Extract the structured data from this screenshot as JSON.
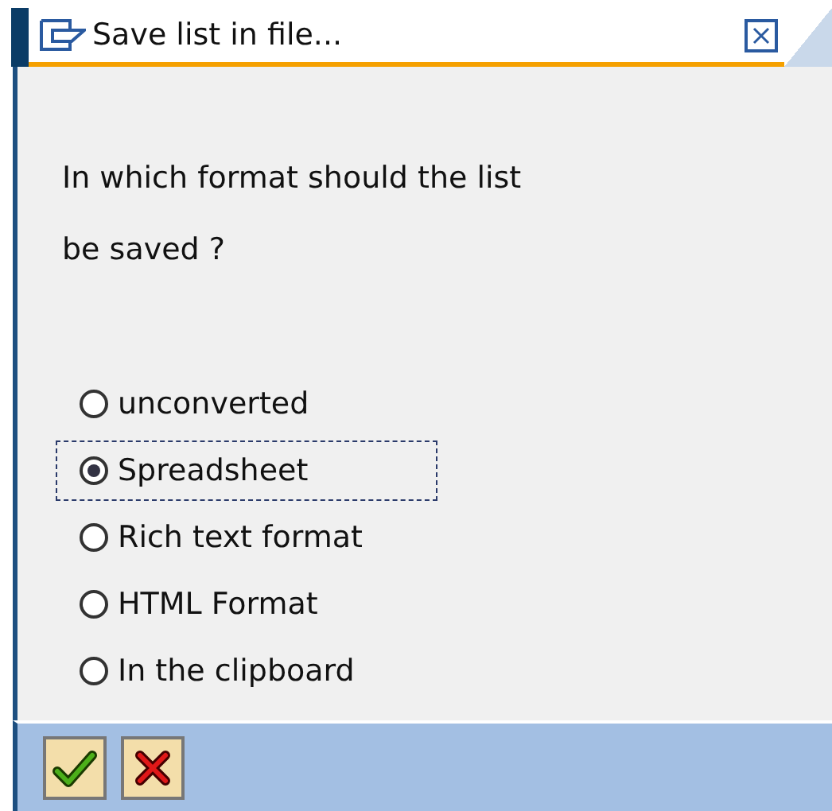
{
  "window": {
    "title": "Save list in file..."
  },
  "prompt": [
    "In which format should the list",
    "be saved ?"
  ],
  "options": [
    {
      "label": "unconverted",
      "selected": false
    },
    {
      "label": "Spreadsheet",
      "selected": true
    },
    {
      "label": "Rich text format",
      "selected": false
    },
    {
      "label": "HTML Format",
      "selected": false
    },
    {
      "label": "In the clipboard",
      "selected": false
    }
  ],
  "buttons": [
    {
      "kind": "confirm"
    },
    {
      "kind": "cancel"
    }
  ]
}
